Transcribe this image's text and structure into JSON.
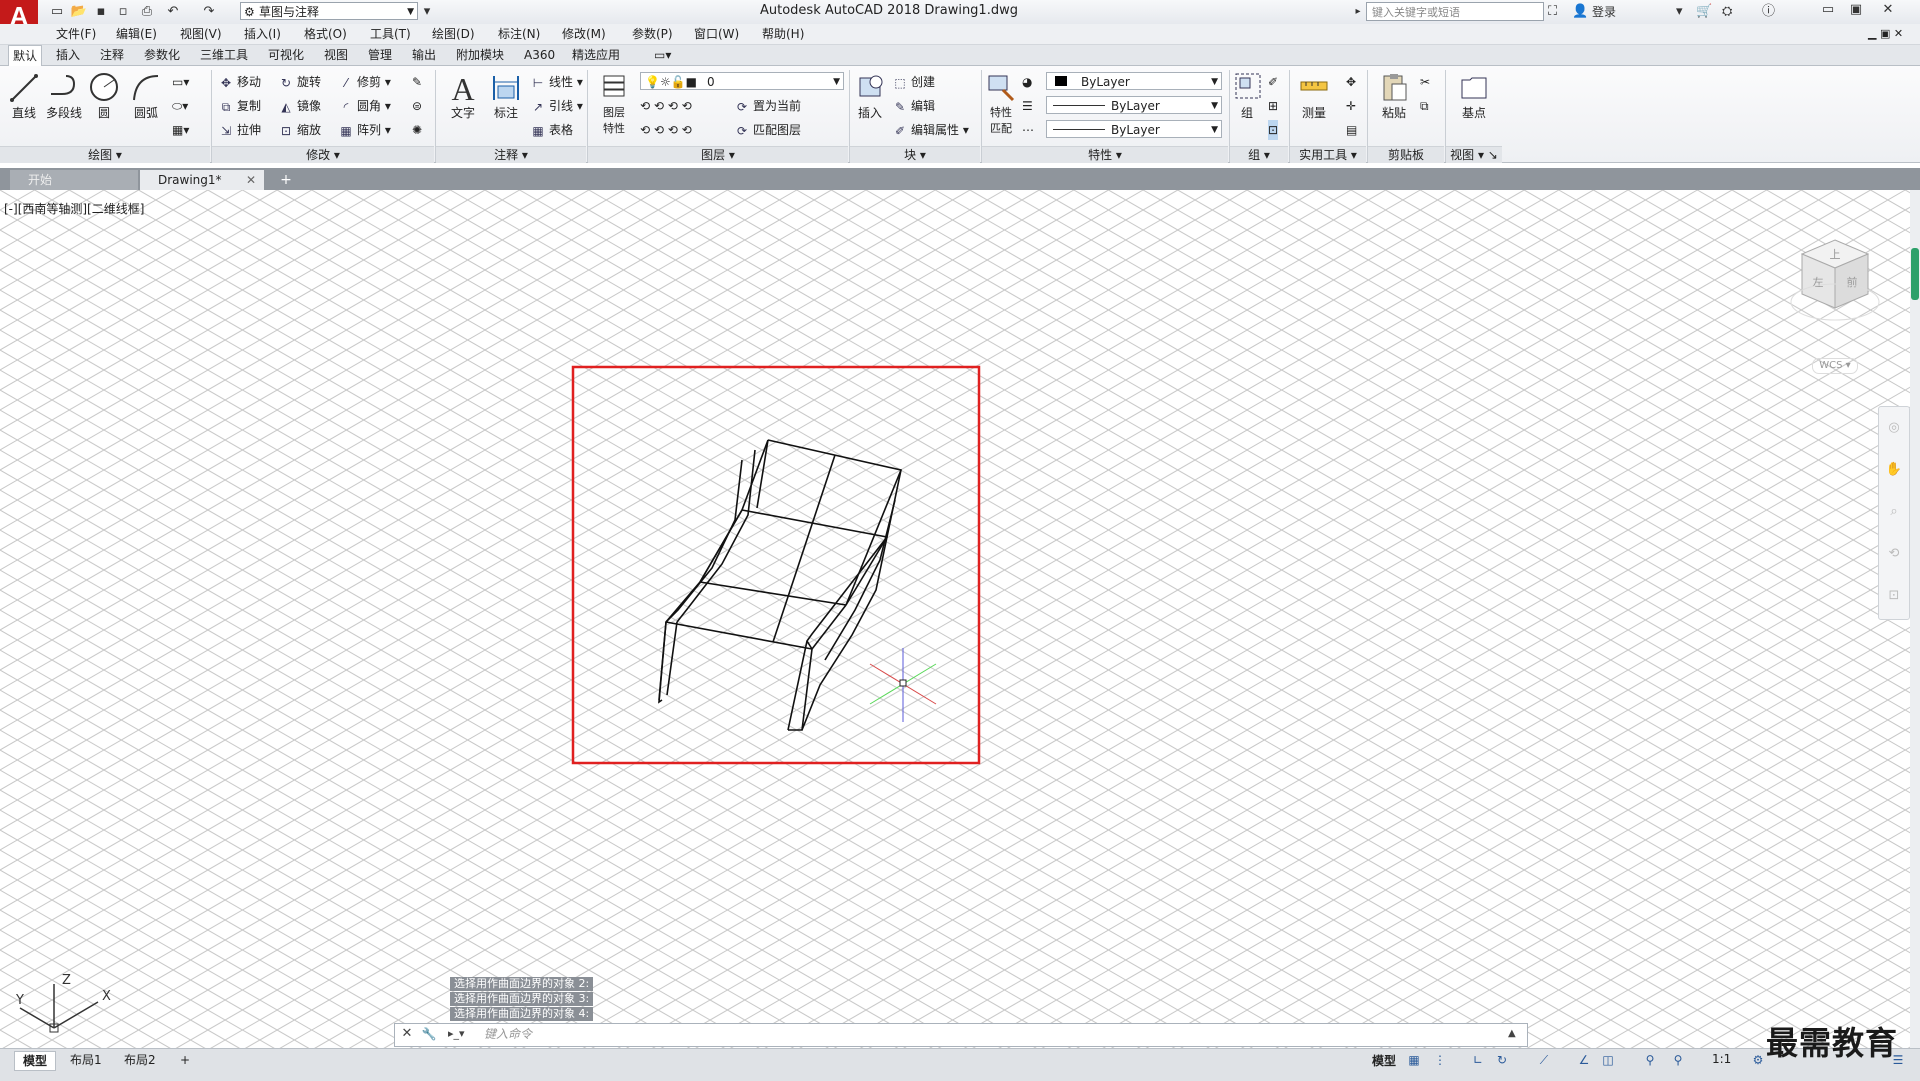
{
  "app": {
    "title": "Autodesk AutoCAD 2018    Drawing1.dwg",
    "logo": "A",
    "workspace": "草图与注释",
    "search_placeholder": "键入关键字或短语",
    "login": "登录"
  },
  "menu": [
    "文件(F)",
    "编辑(E)",
    "视图(V)",
    "插入(I)",
    "格式(O)",
    "工具(T)",
    "绘图(D)",
    "标注(N)",
    "修改(M)",
    "参数(P)",
    "窗口(W)",
    "帮助(H)"
  ],
  "ribbon_tabs": [
    "默认",
    "插入",
    "注释",
    "参数化",
    "三维工具",
    "可视化",
    "视图",
    "管理",
    "输出",
    "附加模块",
    "A360",
    "精选应用"
  ],
  "ribbon": {
    "draw": {
      "title": "绘图",
      "line": "直线",
      "polyline": "多段线",
      "circle": "圆",
      "arc": "圆弧"
    },
    "modify": {
      "title": "修改",
      "move": "移动",
      "rotate": "旋转",
      "trim": "修剪",
      "copy": "复制",
      "mirror": "镜像",
      "fillet": "圆角",
      "stretch": "拉伸",
      "scale": "缩放",
      "array": "阵列"
    },
    "annotation": {
      "title": "注释",
      "text": "文字",
      "dimension": "标注",
      "linear": "线性",
      "leader": "引线",
      "table": "表格"
    },
    "layers": {
      "title": "图层",
      "layer_props": "图层特性",
      "layer_value": "0",
      "set_current": "置为当前",
      "match_layer": "匹配图层"
    },
    "block": {
      "title": "块",
      "insert": "插入",
      "create": "创建",
      "edit": "编辑",
      "edit_attr": "编辑属性"
    },
    "properties": {
      "title": "特性",
      "match": "特性匹配",
      "color": "ByLayer",
      "linetype": "ByLayer",
      "lineweight": "ByLayer"
    },
    "groups": {
      "title": "组",
      "group": "组"
    },
    "utilities": {
      "title": "实用工具",
      "measure": "测量"
    },
    "clipboard": {
      "title": "剪贴板",
      "paste": "粘贴"
    },
    "view": {
      "title": "视图",
      "base": "基点"
    }
  },
  "doc_tabs": {
    "start": "开始",
    "drawing": "Drawing1*"
  },
  "viewport_label": "[-][西南等轴测][二维线框]",
  "viewcube": {
    "top": "上",
    "left": "左",
    "front": "前",
    "wcs": "WCS"
  },
  "ucs": {
    "x": "X",
    "y": "Y",
    "z": "Z"
  },
  "command_history": [
    "选择用作曲面边界的对象 2:",
    "选择用作曲面边界的对象 3:",
    "选择用作曲面边界的对象 4:"
  ],
  "command_placeholder": "键入命令",
  "layout_tabs": [
    "模型",
    "布局1",
    "布局2"
  ],
  "status": {
    "model": "模型",
    "scale": "1:1"
  },
  "watermark": "最需教育",
  "colors": {
    "accent_red": "#e02020",
    "ribbon_bg": "#eef0f3",
    "logo_red": "#c41a1a"
  }
}
